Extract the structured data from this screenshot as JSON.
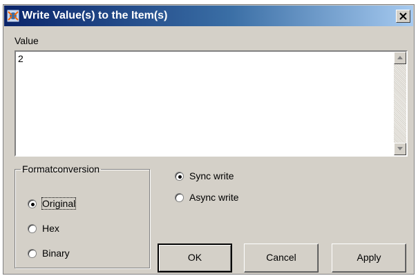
{
  "window": {
    "title": "Write Value(s) to the Item(s)",
    "close_icon": "close-icon"
  },
  "value": {
    "label": "Value",
    "text": "2"
  },
  "format": {
    "legend": "Formatconversion",
    "options": [
      {
        "label": "Original",
        "selected": true
      },
      {
        "label": "Hex",
        "selected": false
      },
      {
        "label": "Binary",
        "selected": false
      }
    ]
  },
  "write_mode": {
    "options": [
      {
        "label": "Sync write",
        "selected": true
      },
      {
        "label": "Async write",
        "selected": false
      }
    ]
  },
  "buttons": {
    "ok": "OK",
    "cancel": "Cancel",
    "apply": "Apply"
  },
  "colors": {
    "titlebar_start": "#0a246a",
    "titlebar_end": "#a6caf0",
    "face": "#d4d0c8"
  }
}
